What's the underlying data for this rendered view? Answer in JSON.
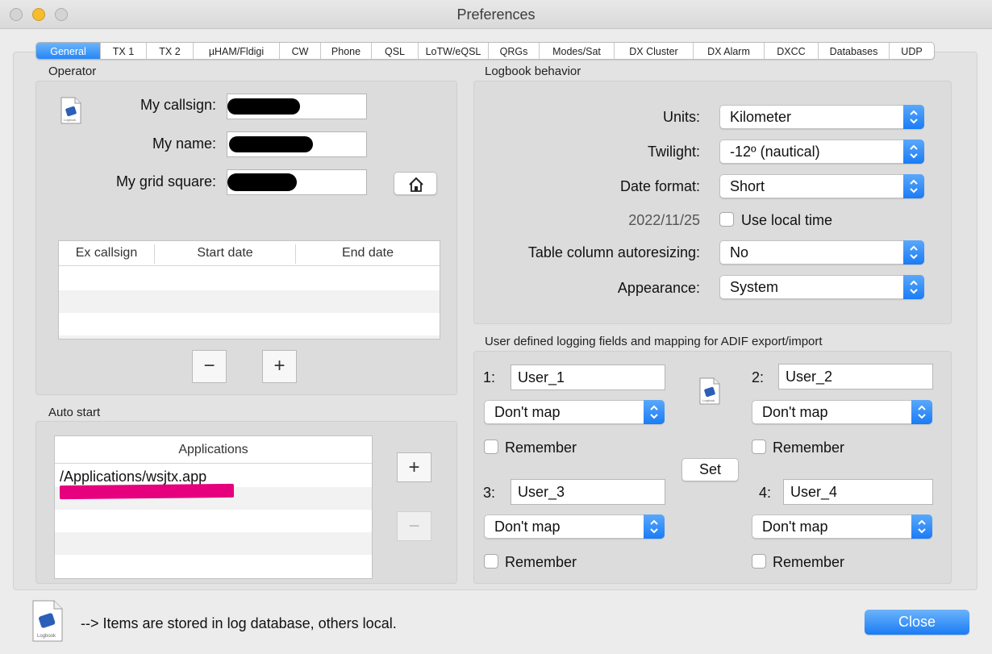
{
  "window": {
    "title": "Preferences"
  },
  "tabs": [
    "General",
    "TX 1",
    "TX 2",
    "µHAM/Fldigi",
    "CW",
    "Phone",
    "QSL",
    "LoTW/eQSL",
    "QRGs",
    "Modes/Sat",
    "DX Cluster",
    "DX Alarm",
    "DXCC",
    "Databases",
    "UDP"
  ],
  "operator": {
    "label": "Operator",
    "callsign_label": "My callsign:",
    "name_label": "My name:",
    "grid_label": "My grid square:",
    "home_icon": "house-icon",
    "ex_table": {
      "headers": [
        "Ex callsign",
        "Start date",
        "End date"
      ]
    },
    "remove_label": "−",
    "add_label": "+"
  },
  "auto_start": {
    "label": "Auto start",
    "header": "Applications",
    "rows": [
      "/Applications/wsjtx.app"
    ],
    "add_label": "+",
    "remove_label": "−"
  },
  "logbook": {
    "label": "Logbook behavior",
    "units_label": "Units:",
    "units_value": "Kilometer",
    "twilight_label": "Twilight:",
    "twilight_value": "-12º (nautical)",
    "date_label": "Date format:",
    "date_value": "Short",
    "date_sample": "2022/11/25",
    "local_time_label": "Use local time",
    "autoresize_label": "Table column autoresizing:",
    "autoresize_value": "No",
    "appearance_label": "Appearance:",
    "appearance_value": "System"
  },
  "user_fields": {
    "label": "User defined logging fields and mapping for ADIF export/import",
    "items": [
      {
        "num": "1:",
        "value": "User_1",
        "map": "Don't map",
        "remember": "Remember"
      },
      {
        "num": "2:",
        "value": "User_2",
        "map": "Don't map",
        "remember": "Remember"
      },
      {
        "num": "3:",
        "value": "User_3",
        "map": "Don't map",
        "remember": "Remember"
      },
      {
        "num": "4:",
        "value": "User_4",
        "map": "Don't map",
        "remember": "Remember"
      }
    ],
    "set_label": "Set"
  },
  "footer": {
    "note": "--> Items are stored in log database, others local.",
    "close_label": "Close"
  },
  "colors": {
    "accent": "#1e82f6",
    "highlight": "#e6007e"
  }
}
